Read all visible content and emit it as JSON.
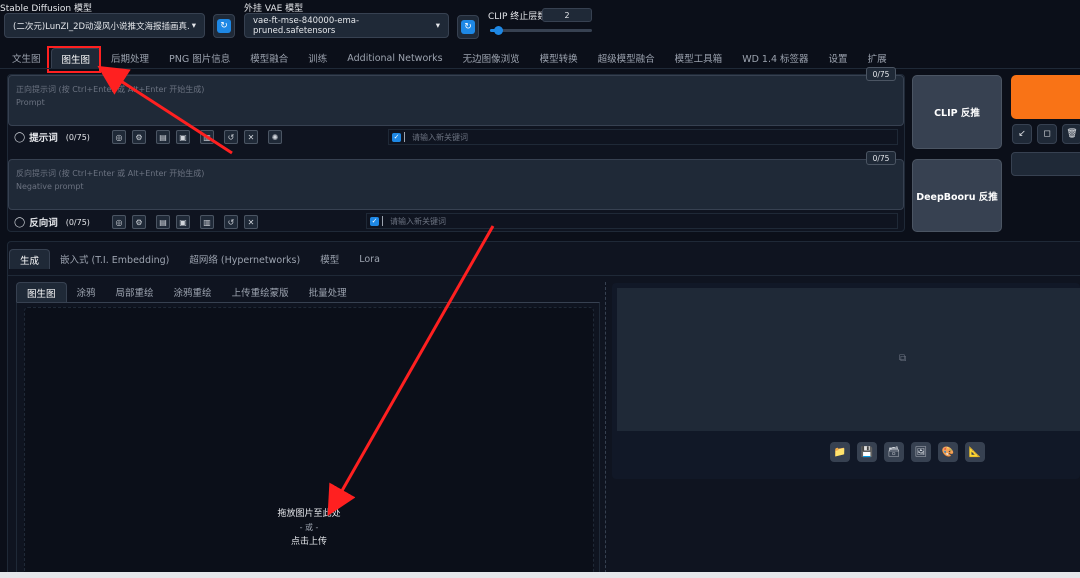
{
  "header": {
    "sd_model_label": "Stable Diffusion 模型",
    "sd_model_value": "(二次元)LunZI_2D动漫风小说推文海报插画真.",
    "vae_label": "外挂 VAE 模型",
    "vae_value": "vae-ft-mse-840000-ema-pruned.safetensors",
    "clip_label": "CLIP 终止层数",
    "clip_value": "2",
    "clip_fraction": 0.08
  },
  "main_tabs": [
    "文生图",
    "图生图",
    "后期处理",
    "PNG 图片信息",
    "模型融合",
    "训练",
    "Additional Networks",
    "无边图像浏览",
    "模型转换",
    "超级模型融合",
    "模型工具箱",
    "WD 1.4 标签器",
    "设置",
    "扩展"
  ],
  "main_tabs_active": 1,
  "prompt": {
    "placeholder1": "正向提示词 (按 Ctrl+Enter 或 Alt+Enter 开始生成)",
    "placeholder2": "Prompt",
    "counter": "0/75",
    "toolbar_label": "提示词",
    "toolbar_count": "(0/75)",
    "keyword_placeholder": "请输入新关键词"
  },
  "negative": {
    "placeholder1": "反向提示词 (按 Ctrl+Enter 或 Alt+Enter 开始生成)",
    "placeholder2": "Negative prompt",
    "counter": "0/75",
    "toolbar_label": "反向词",
    "toolbar_count": "(0/75)",
    "keyword_placeholder": "请输入新关键词"
  },
  "side_buttons": {
    "clip": "CLIP 反推",
    "deepbooru": "DeepBooru 反推"
  },
  "sub_tabs": [
    "生成",
    "嵌入式 (T.I. Embedding)",
    "超网络 (Hypernetworks)",
    "模型",
    "Lora"
  ],
  "img_tabs": [
    "图生图",
    "涂鸦",
    "局部重绘",
    "涂鸦重绘",
    "上传重绘蒙版",
    "批量处理"
  ],
  "upload": {
    "line1": "拖放图片至此处",
    "line2": "- 或 -",
    "line3": "点击上传"
  },
  "colors": {
    "accent": "#1e88e5",
    "generate": "#f97316",
    "highlight": "#ff2020"
  }
}
